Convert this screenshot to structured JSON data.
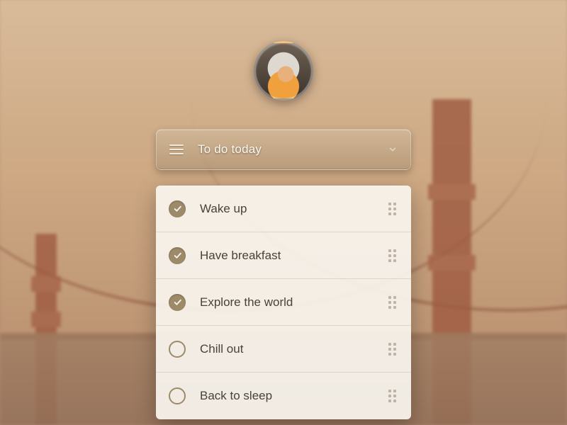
{
  "header": {
    "list_title": "To do today"
  },
  "tasks": [
    {
      "label": "Wake up",
      "done": true
    },
    {
      "label": "Have breakfast",
      "done": true
    },
    {
      "label": "Explore the world",
      "done": true
    },
    {
      "label": "Chill out",
      "done": false
    },
    {
      "label": "Back to sleep",
      "done": false
    }
  ],
  "icons": {
    "menu": "hamburger-icon",
    "dropdown": "chevron-down-icon",
    "drag": "drag-handle-icon",
    "check": "checkmark-icon"
  },
  "colors": {
    "accent": "#9d8a69",
    "card_bg": "#f8f5ef",
    "text": "#4a4238"
  }
}
